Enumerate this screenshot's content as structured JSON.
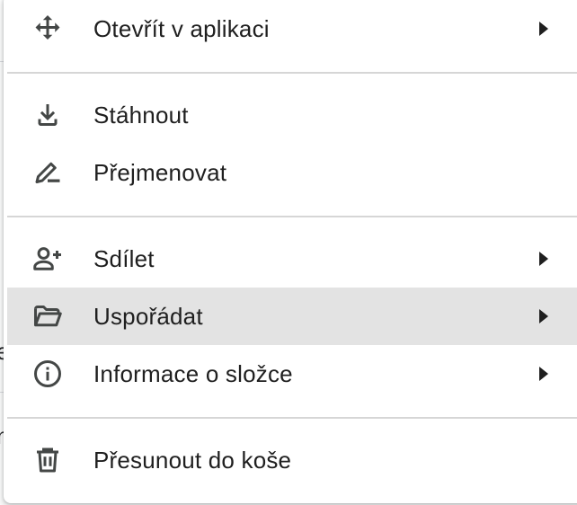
{
  "background": {
    "fragment_1": "e",
    "fragment_2": "n"
  },
  "menu": {
    "items": [
      {
        "id": "open-in-app",
        "label": "Otevřít v aplikaci",
        "icon": "move-arrows-icon",
        "submenu": true
      },
      {
        "id": "download",
        "label": "Stáhnout",
        "icon": "download-icon",
        "submenu": false
      },
      {
        "id": "rename",
        "label": "Přejmenovat",
        "icon": "pencil-icon",
        "submenu": false
      },
      {
        "id": "share",
        "label": "Sdílet",
        "icon": "person-add-icon",
        "submenu": true
      },
      {
        "id": "organize",
        "label": "Uspořádat",
        "icon": "folder-open-icon",
        "submenu": true,
        "highlighted": true
      },
      {
        "id": "folder-info",
        "label": "Informace o složce",
        "icon": "info-icon",
        "submenu": true
      },
      {
        "id": "move-to-trash",
        "label": "Přesunout do koše",
        "icon": "trash-icon",
        "submenu": false
      }
    ]
  },
  "colors": {
    "text": "#1f1f1f",
    "icon": "#444746",
    "hover": "#e3e3e3",
    "divider": "#d6d6d6"
  }
}
